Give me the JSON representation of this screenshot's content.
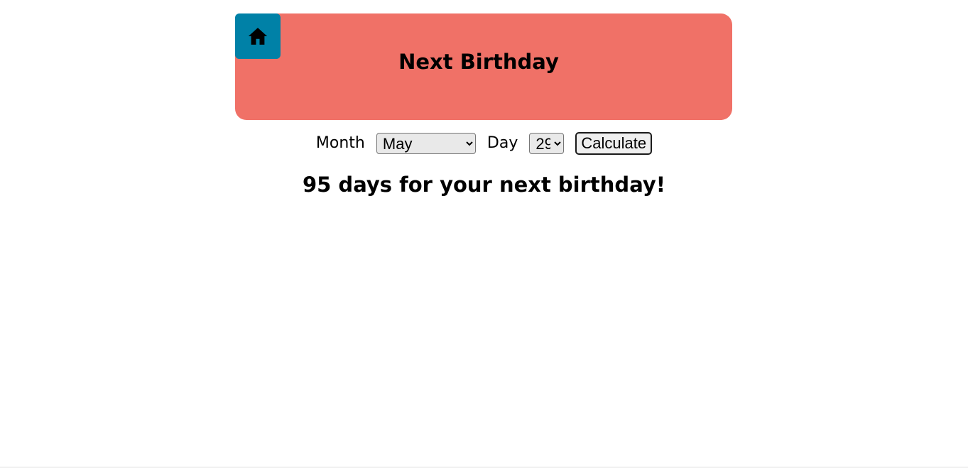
{
  "header": {
    "title": "Next Birthday",
    "home_icon": "home-icon",
    "background_color": "#f07167",
    "home_button_color": "#0081a7"
  },
  "form": {
    "month_label": "Month",
    "month_selected": "May",
    "day_label": "Day",
    "day_selected": "29",
    "calculate_label": "Calculate"
  },
  "result": {
    "message": "95 days for your next birthday!"
  }
}
